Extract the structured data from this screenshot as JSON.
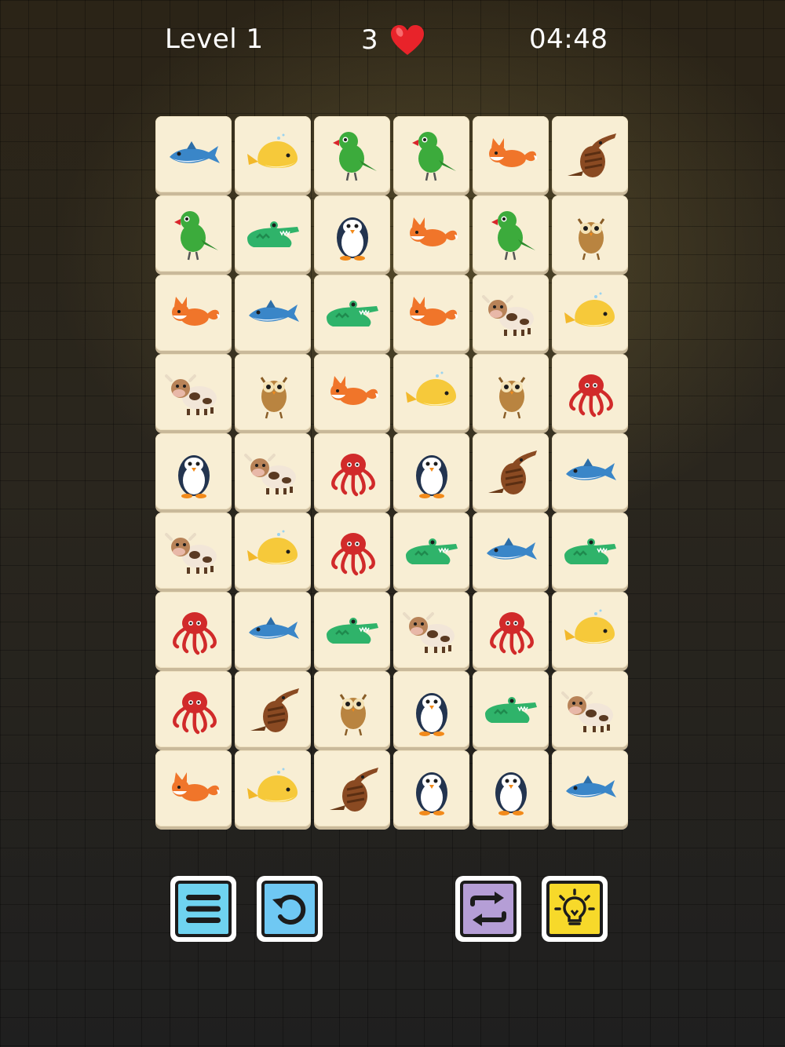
{
  "hud": {
    "level_label": "Level 1",
    "lives": "3",
    "timer": "04:48"
  },
  "board": {
    "rows": [
      [
        "shark",
        "whale",
        "parrot",
        "parrot",
        "fox",
        "anteater"
      ],
      [
        "parrot",
        "crocodile",
        "penguin",
        "fox",
        "parrot",
        "owl"
      ],
      [
        "fox",
        "shark",
        "crocodile",
        "fox",
        "cow",
        "whale"
      ],
      [
        "cow",
        "owl",
        "fox",
        "whale",
        "owl",
        "octopus"
      ],
      [
        "penguin",
        "cow",
        "octopus",
        "penguin",
        "anteater",
        "shark"
      ],
      [
        "cow",
        "whale",
        "octopus",
        "crocodile",
        "shark",
        "crocodile"
      ],
      [
        "octopus",
        "shark",
        "crocodile",
        "cow",
        "octopus",
        "whale"
      ],
      [
        "octopus",
        "anteater",
        "owl",
        "penguin",
        "crocodile",
        "cow"
      ],
      [
        "fox",
        "whale",
        "anteater",
        "penguin",
        "penguin",
        "shark"
      ]
    ]
  },
  "toolbar": {
    "buttons": [
      {
        "name": "menu-button",
        "icon": "menu-icon",
        "color": "#6fd3f0"
      },
      {
        "name": "undo-button",
        "icon": "undo-icon",
        "color": "#6fc8f3"
      },
      {
        "name": "shuffle-button",
        "icon": "shuffle-icon",
        "color": "#b59ed6"
      },
      {
        "name": "hint-button",
        "icon": "lightbulb-icon",
        "color": "#f7d92a"
      }
    ]
  },
  "colors": {
    "tile": "#f8eed4",
    "heart": "#e8232a"
  }
}
